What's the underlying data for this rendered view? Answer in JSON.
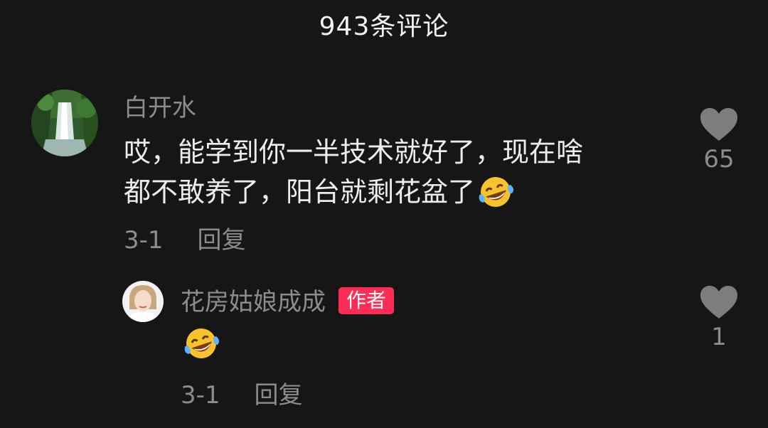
{
  "header": {
    "title": "943条评论"
  },
  "comments": [
    {
      "username": "白开水",
      "text_line1": "哎，能学到你一半技术就好了，现在啥",
      "text_line2": "都不敢养了，阳台就剩花盆了",
      "emoji": "tears-of-joy-emoji",
      "date": "3-1",
      "reply_label": "回复",
      "likes": "65",
      "avatar": "waterfall-avatar"
    },
    {
      "username": "花房姑娘成成",
      "badge": "作者",
      "emoji": "tears-of-joy-emoji",
      "date": "3-1",
      "reply_label": "回复",
      "likes": "1",
      "avatar": "woman-portrait-avatar"
    }
  ],
  "colors": {
    "background": "#161616",
    "badge": "#ff2d55",
    "muted": "#8c8c8c"
  }
}
